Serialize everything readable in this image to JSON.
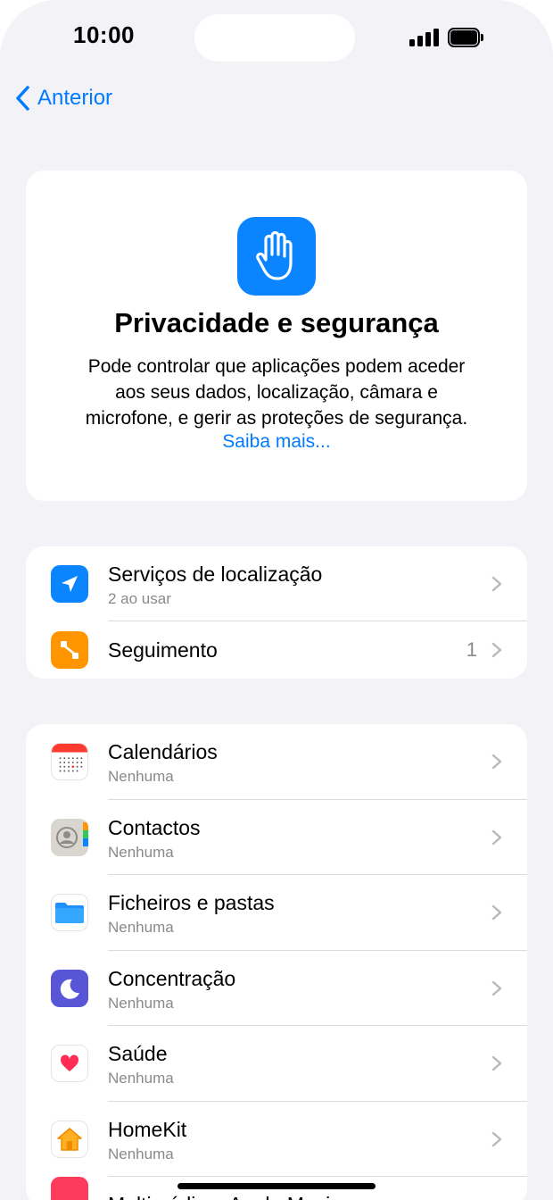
{
  "status_bar": {
    "time": "10:00"
  },
  "nav": {
    "back_label": "Anterior"
  },
  "hero": {
    "icon": "hand-raised-icon",
    "title": "Privacidade e segurança",
    "description_lines": [
      "Pode controlar que aplicações podem aceder",
      "aos seus dados, localização, câmara e",
      "microfone, e gerir as proteções de segurança."
    ],
    "link": "Saiba mais..."
  },
  "group1": [
    {
      "icon": "location-arrow-icon",
      "title": "Serviços de localização",
      "subtitle": "2 ao usar",
      "value": ""
    },
    {
      "icon": "tracking-icon",
      "title": "Seguimento",
      "subtitle": "",
      "value": "1"
    }
  ],
  "group2": [
    {
      "icon": "calendar-icon",
      "title": "Calendários",
      "subtitle": "Nenhuma"
    },
    {
      "icon": "contacts-icon",
      "title": "Contactos",
      "subtitle": "Nenhuma"
    },
    {
      "icon": "folder-icon",
      "title": "Ficheiros e pastas",
      "subtitle": "Nenhuma"
    },
    {
      "icon": "moon-icon",
      "title": "Concentração",
      "subtitle": "Nenhuma"
    },
    {
      "icon": "heart-icon",
      "title": "Saúde",
      "subtitle": "Nenhuma"
    },
    {
      "icon": "home-icon",
      "title": "HomeKit",
      "subtitle": "Nenhuma"
    },
    {
      "icon": "music-icon",
      "title": "Multimédia e Apple Music",
      "subtitle": ""
    }
  ],
  "colors": {
    "accent": "#007aff",
    "background": "#f2f2f7",
    "location": "#0a84ff",
    "tracking": "#ff9500",
    "focus": "#5856d6",
    "health": "#ff2d55"
  }
}
